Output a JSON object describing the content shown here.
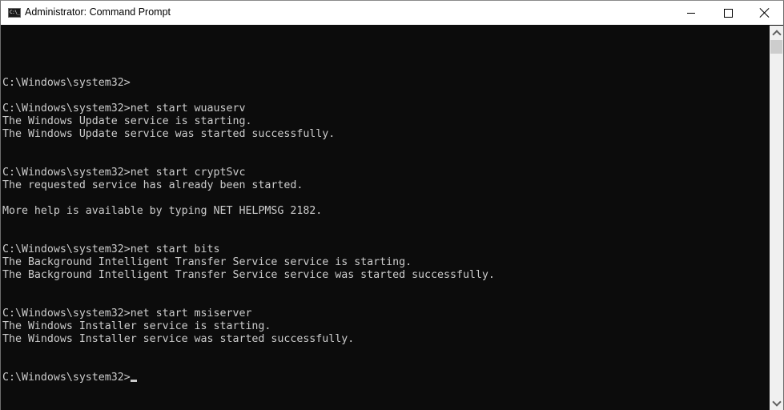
{
  "window": {
    "title": "Administrator: Command Prompt",
    "icon": "cmd-app-icon",
    "icon_text": "C:\\_",
    "controls": {
      "minimize": "minimize-icon",
      "maximize": "maximize-icon",
      "close": "close-icon"
    }
  },
  "console": {
    "colors": {
      "background": "#0c0c0c",
      "text": "#cccccc"
    },
    "lines": [
      "",
      "",
      "C:\\Windows\\system32>",
      "",
      "C:\\Windows\\system32>net start wuauserv",
      "The Windows Update service is starting.",
      "The Windows Update service was started successfully.",
      "",
      "",
      "C:\\Windows\\system32>net start cryptSvc",
      "The requested service has already been started.",
      "",
      "More help is available by typing NET HELPMSG 2182.",
      "",
      "",
      "C:\\Windows\\system32>net start bits",
      "The Background Intelligent Transfer Service service is starting.",
      "The Background Intelligent Transfer Service service was started successfully.",
      "",
      "",
      "C:\\Windows\\system32>net start msiserver",
      "The Windows Installer service is starting.",
      "The Windows Installer service was started successfully.",
      "",
      ""
    ],
    "current_prompt": "C:\\Windows\\system32>",
    "current_input": ""
  },
  "scrollbar": {
    "up_icon": "chevron-up-icon",
    "down_icon": "chevron-down-icon",
    "position": 0
  }
}
